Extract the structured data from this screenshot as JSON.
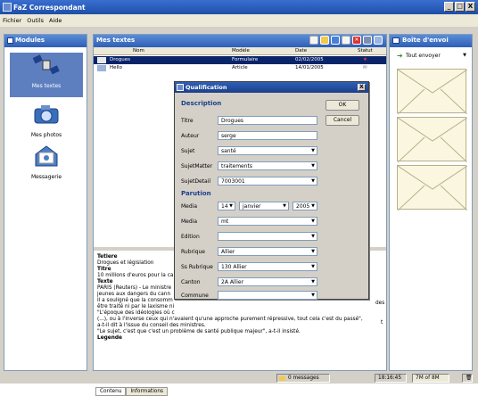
{
  "window": {
    "title": "FaZ Correspondant",
    "minimize": "_",
    "maximize": "□",
    "close": "X"
  },
  "menu": [
    "Fichier",
    "Outils",
    "Aide"
  ],
  "modules": {
    "title": "Modules",
    "items": [
      {
        "label": "Mes textes",
        "icon": "satellite-icon"
      },
      {
        "label": "Mes photos",
        "icon": "camera-icon"
      },
      {
        "label": "Messagerie",
        "icon": "mail-icon"
      }
    ]
  },
  "main": {
    "title": "Mes textes",
    "toolbar_icons": [
      "new-document-icon",
      "open-icon",
      "save-icon",
      "copy-icon",
      "delete-icon",
      "print-icon",
      "send-icon"
    ],
    "columns": [
      "Nom",
      "Modèle",
      "Date",
      "Statut"
    ],
    "rows": [
      {
        "nom": "Drogues",
        "modele": "Formulaire",
        "date": "02/02/2005",
        "statut": "★"
      },
      {
        "nom": "Hello",
        "modele": "Article",
        "date": "14/01/2005",
        "statut": "✉"
      }
    ],
    "text_lines": [
      {
        "bold": true,
        "text": "Tetiere"
      },
      {
        "bold": false,
        "text": "Drogues et législation"
      },
      {
        "bold": true,
        "text": "Titre"
      },
      {
        "bold": false,
        "text": "10 millions d'euros pour la car"
      },
      {
        "bold": true,
        "text": "Texte"
      },
      {
        "bold": false,
        "text": "PARIS (Reuters) - Le ministre"
      },
      {
        "bold": false,
        "text": "jeunes aux dangers du cann"
      },
      {
        "bold": false,
        "text": "Il a souligné que la consomm"
      },
      {
        "bold": false,
        "text": "être traité ni par le laxisme ni"
      },
      {
        "bold": false,
        "text": "\"L'époque des idéologies où c"
      },
      {
        "bold": false,
        "text": "(...), ou à l'inverse ceux qui n'avaient qu'une approche purement répressive, tout cela c'est du passé\","
      },
      {
        "bold": false,
        "text": "a-t-il dit à l'issue du conseil des ministres."
      },
      {
        "bold": false,
        "text": "\"Le sujet, c'est que c'est un problème de santé publique majeur\", a-t-il insisté."
      },
      {
        "bold": true,
        "text": "Legende"
      }
    ],
    "right_fragments": [
      "des",
      "t"
    ],
    "tabs": [
      "Contenu",
      "Informations"
    ]
  },
  "outbox": {
    "title": "Boîte d'envoi",
    "send_label": "Tout envoyer",
    "envelope_count": 3
  },
  "statusbar": {
    "messages": "0 messages",
    "time": "18:16:45",
    "memory": "7M of 8M"
  },
  "dialog": {
    "title": "Qualification",
    "close": "X",
    "ok_label": "OK",
    "cancel_label": "Cancel",
    "description_heading": "Description",
    "parution_heading": "Parution",
    "fields": {
      "titre": {
        "label": "Titre",
        "value": "Drogues"
      },
      "auteur": {
        "label": "Auteur",
        "value": "serge"
      },
      "sujet": {
        "label": "Sujet",
        "value": "santé"
      },
      "subjectmatter": {
        "label": "SujetMatter",
        "value": "traitements"
      },
      "subjectdetail": {
        "label": "SujetDetail",
        "value": "7003001"
      },
      "media_date": {
        "label": "Media",
        "day": "14",
        "month": "janvier",
        "year": "2005"
      },
      "media": {
        "label": "Media",
        "value": "mt"
      },
      "edition": {
        "label": "Edition",
        "value": ""
      },
      "rubrique": {
        "label": "Rubrique",
        "value": "Allier"
      },
      "ssrubrique": {
        "label": "Ss Rubrique",
        "value": "130 Allier"
      },
      "canton": {
        "label": "Canton",
        "value": "2A Allier"
      },
      "commune": {
        "label": "Commune",
        "value": ""
      }
    }
  },
  "colors": {
    "accent": "#2e5fb4",
    "selection": "#0a246a",
    "panel": "#d4d0c8"
  }
}
